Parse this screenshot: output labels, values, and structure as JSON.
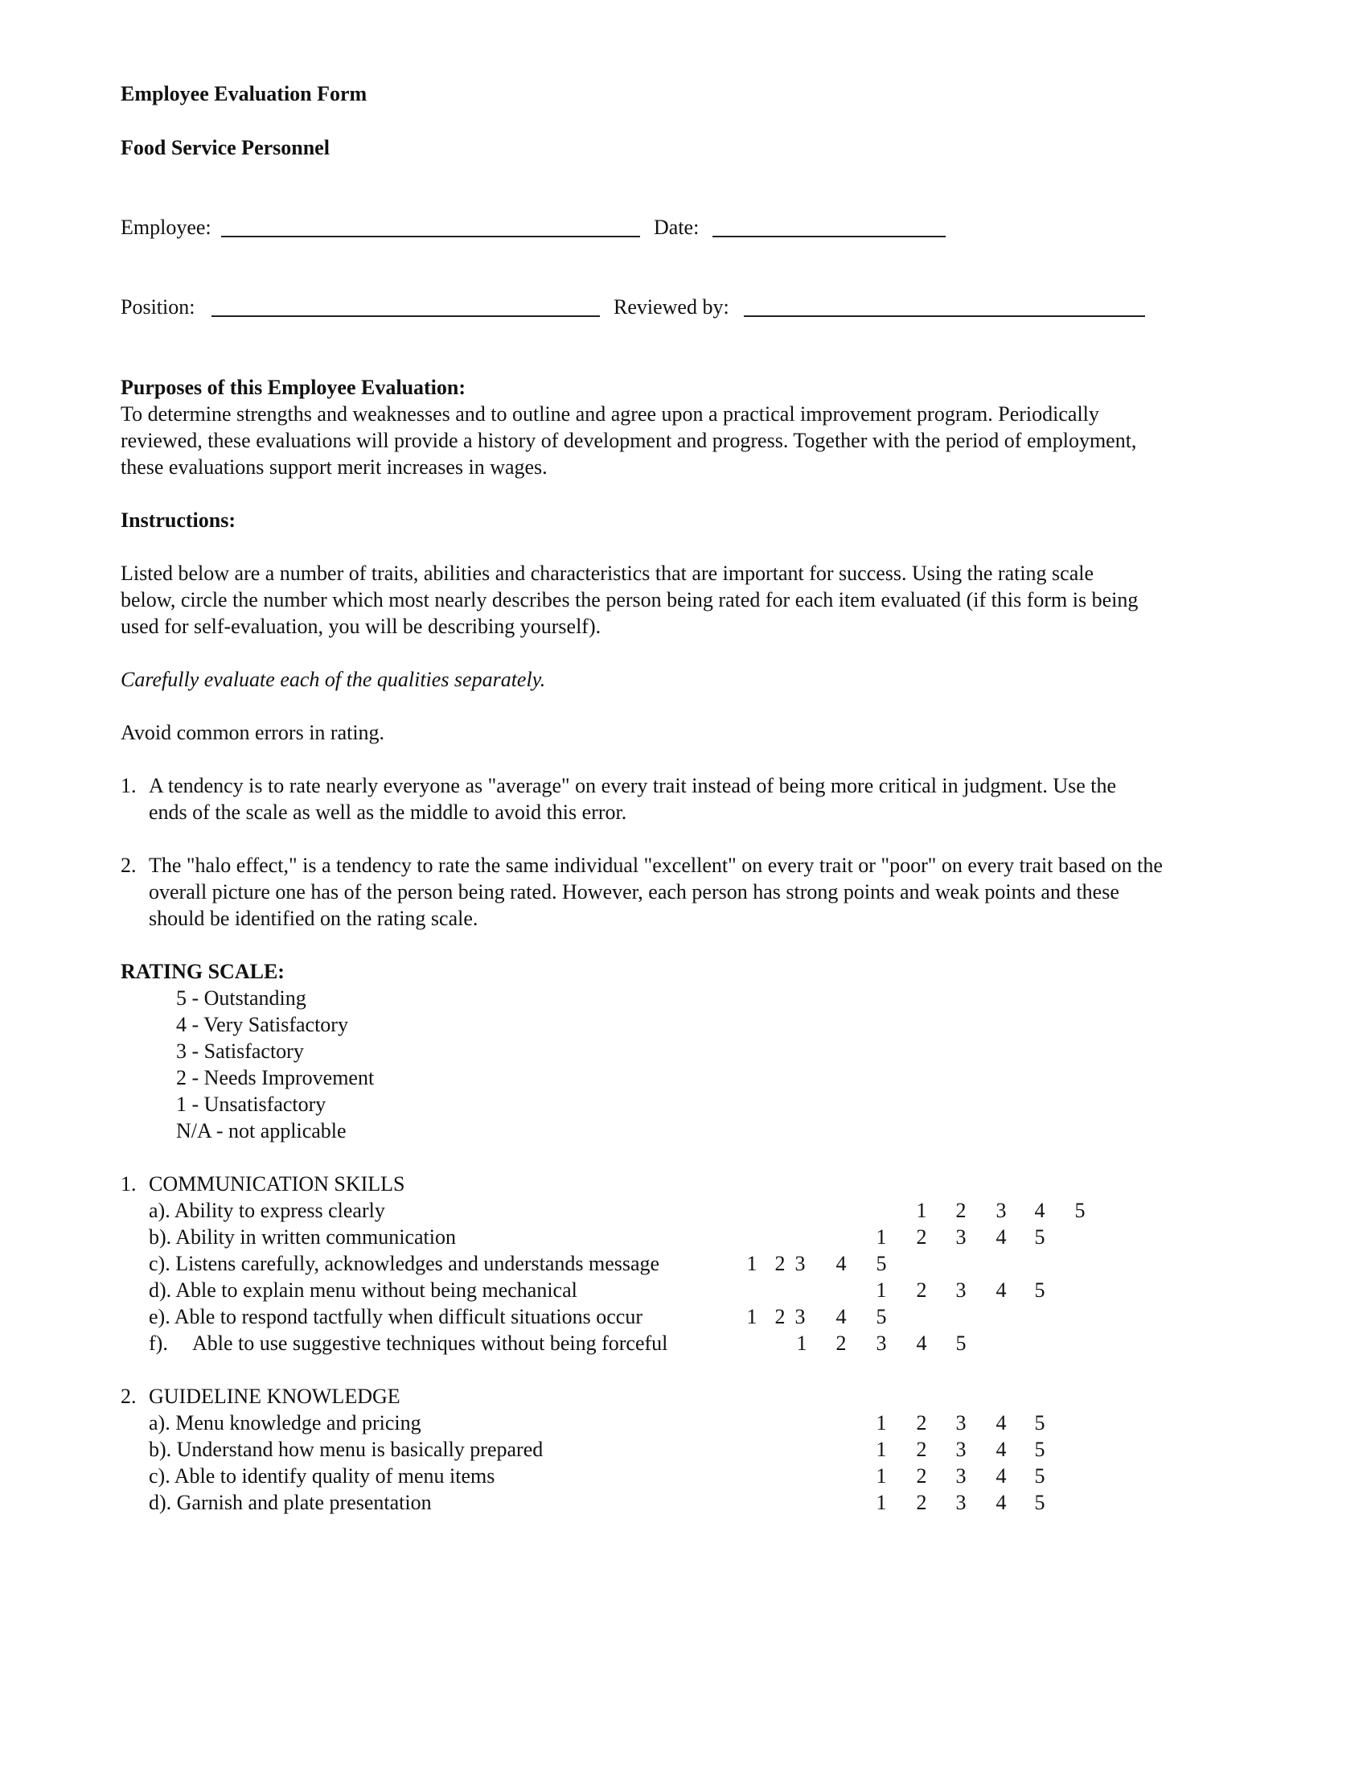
{
  "header": {
    "title": "Employee Evaluation Form",
    "subtitle": "Food Service Personnel"
  },
  "fields": {
    "employee_label": "Employee:",
    "employee_value": "",
    "date_label": "Date:",
    "date_value": "",
    "position_label": "Position:",
    "position_value": "",
    "reviewed_by_label": "Reviewed by:",
    "reviewed_by_value": ""
  },
  "purposes": {
    "heading": "Purposes of this Employee Evaluation:",
    "lines": [
      "To determine strengths and weaknesses and to outline and agree upon a practical improvement program.  Periodically",
      "reviewed, these evaluations will provide a history of development and progress.  Together with the period of employment,",
      "these evaluations support merit increases in wages."
    ]
  },
  "instructions": {
    "heading": "Instructions:",
    "lines": [
      "Listed below are a number of traits, abilities and characteristics that are important for success.  Using the rating scale",
      "below, circle the number which most nearly describes the person being rated for each item evaluated (if this form is being",
      "used for self-evaluation, you will be describing yourself)."
    ],
    "emphasis": "Carefully evaluate each of the qualities separately.",
    "avoid": "Avoid common errors in rating.",
    "errors": [
      {
        "number": "1.",
        "lines": [
          "A tendency is to rate nearly everyone as \"average\" on every trait instead of being more critical in judgment.  Use the",
          "ends of the scale as well as the middle to avoid this error."
        ]
      },
      {
        "number": "2.",
        "lines": [
          "The \"halo effect,\" is a tendency to rate the same individual \"excellent\" on every trait or \"poor\" on every trait based on the",
          "overall picture one has of the person being rated.  However, each person has strong points and weak points and these",
          "should be identified on the rating scale."
        ]
      }
    ]
  },
  "rating_scale": {
    "heading": "RATING SCALE:",
    "levels": [
      "5 - Outstanding",
      "4 - Very Satisfactory",
      "3 - Satisfactory",
      "2 - Needs Improvement",
      "1 - Unsatisfactory",
      "N/A - not applicable"
    ]
  },
  "sections": [
    {
      "number": "1.",
      "title": "COMMUNICATION SKILLS",
      "items": [
        {
          "label": "a). Ability to express clearly",
          "ratings": [
            "1",
            "2",
            "3",
            "4",
            "5"
          ]
        },
        {
          "label": "b). Ability in written communication",
          "ratings": [
            "1",
            "2",
            "3",
            "4",
            "5"
          ]
        },
        {
          "label": "c). Listens carefully, acknowledges and understands message",
          "ratings": [
            "1",
            "2",
            "3",
            "4",
            "5"
          ]
        },
        {
          "label": "d). Able to explain menu without being mechanical",
          "ratings": [
            "1",
            "2",
            "3",
            "4",
            "5"
          ]
        },
        {
          "label": "e). Able to respond tactfully when difficult situations occur",
          "ratings": [
            "1",
            "2",
            "3",
            "4",
            "5"
          ]
        },
        {
          "label_prefix": "f).",
          "label": "Able to use suggestive techniques without being forceful",
          "ratings": [
            "1",
            "2",
            "3",
            "4",
            "5"
          ]
        }
      ]
    },
    {
      "number": "2.",
      "title": "GUIDELINE KNOWLEDGE",
      "items": [
        {
          "label": "a). Menu knowledge and pricing",
          "ratings": [
            "1",
            "2",
            "3",
            "4",
            "5"
          ]
        },
        {
          "label": "b). Understand how menu is basically prepared",
          "ratings": [
            "1",
            "2",
            "3",
            "4",
            "5"
          ]
        },
        {
          "label": "c). Able to identify quality of menu items",
          "ratings": [
            "1",
            "2",
            "3",
            "4",
            "5"
          ]
        },
        {
          "label": "d). Garnish and plate presentation",
          "ratings": [
            "1",
            "2",
            "3",
            "4",
            "5"
          ]
        }
      ]
    }
  ]
}
